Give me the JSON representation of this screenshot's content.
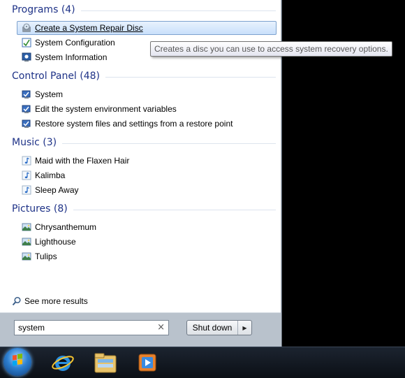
{
  "groups": {
    "programs": {
      "title": "Programs (4)",
      "items": [
        {
          "label": "Create a System Repair Disc",
          "icon": "repair-disc-icon"
        },
        {
          "label": "System Configuration",
          "icon": "system-config-icon"
        },
        {
          "label": "System Information",
          "icon": "system-info-icon"
        }
      ]
    },
    "control_panel": {
      "title": "Control Panel (48)",
      "items": [
        {
          "label": "System",
          "icon": "control-panel-icon"
        },
        {
          "label": "Edit the system environment variables",
          "icon": "control-panel-icon"
        },
        {
          "label": "Restore system files and settings from a restore point",
          "icon": "control-panel-icon"
        }
      ]
    },
    "music": {
      "title": "Music (3)",
      "items": [
        {
          "label": "Maid with the Flaxen Hair",
          "icon": "music-note-icon"
        },
        {
          "label": "Kalimba",
          "icon": "music-note-icon"
        },
        {
          "label": "Sleep Away",
          "icon": "music-note-icon"
        }
      ]
    },
    "pictures": {
      "title": "Pictures (8)",
      "items": [
        {
          "label": "Chrysanthemum",
          "icon": "picture-icon"
        },
        {
          "label": "Lighthouse",
          "icon": "picture-icon"
        },
        {
          "label": "Tulips",
          "icon": "picture-icon"
        }
      ]
    }
  },
  "tooltip": "Creates a disc you can use to access system recovery options.",
  "see_more": "See more results",
  "search": {
    "value": "system",
    "clear": "×"
  },
  "shutdown": {
    "label": "Shut down",
    "arrow": "▶"
  },
  "taskbar": [
    "start-orb",
    "internet-explorer-icon",
    "windows-explorer-icon",
    "media-player-icon"
  ],
  "colors": {
    "group_title": "#1e3287",
    "selection_border": "#7da2ce",
    "taskbar": "#0b0f15"
  }
}
